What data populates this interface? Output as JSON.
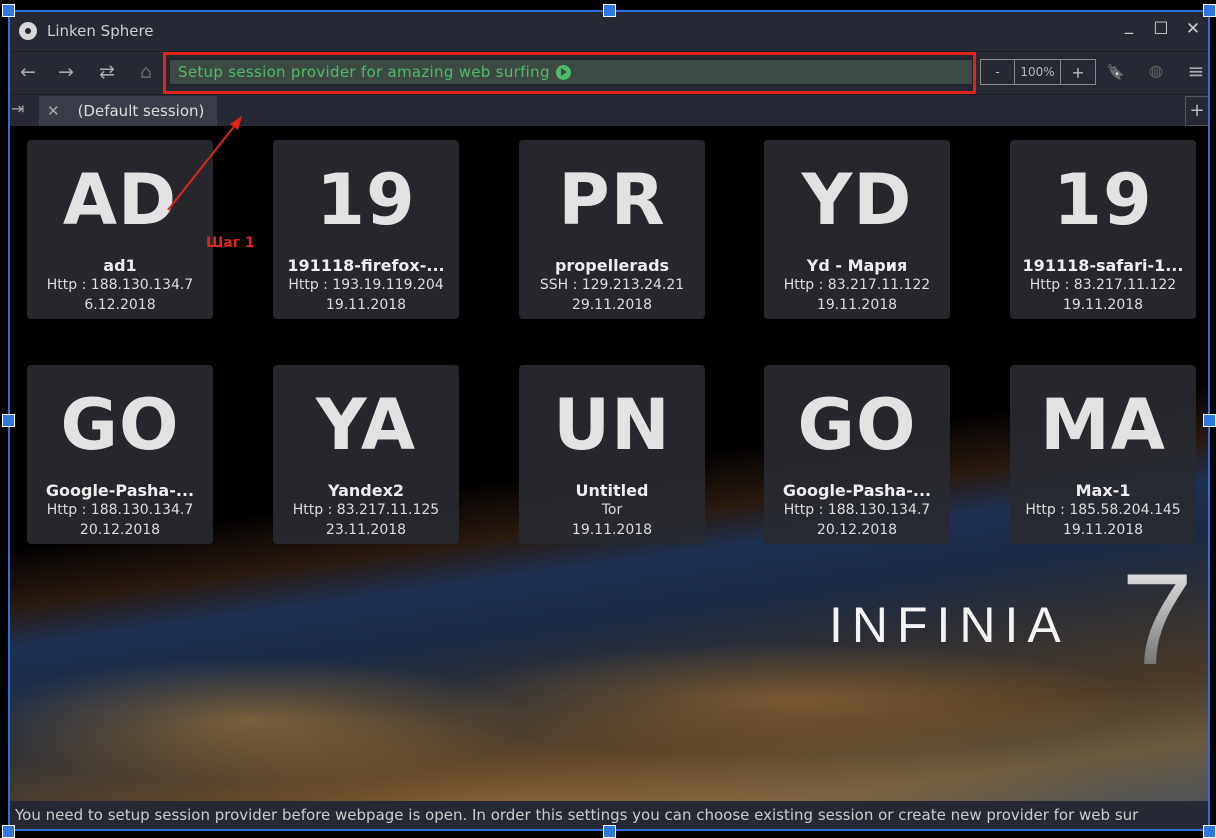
{
  "window": {
    "title": "Linken Sphere",
    "minimize": "_",
    "maximize": "☐",
    "close": "✕"
  },
  "toolbar": {
    "back": "←",
    "forward": "→",
    "reload": "⇄",
    "home": "⌂",
    "address": "Setup session provider for amazing web surfing",
    "zoom_out": "-",
    "zoom_level": "100%",
    "zoom_in": "+",
    "bookmark": "🔖",
    "extension": "◍",
    "menu": "≡"
  },
  "tabs": {
    "exit": "⇥",
    "close": "✕",
    "active": "(Default session)",
    "new": "+"
  },
  "sessions": [
    {
      "abbr": "AD",
      "name": "ad1",
      "conn": "Http : 188.130.134.7",
      "date": "6.12.2018"
    },
    {
      "abbr": "19",
      "name": "191118-firefox-...",
      "conn": "Http : 193.19.119.204",
      "date": "19.11.2018"
    },
    {
      "abbr": "PR",
      "name": "propellerads",
      "conn": "SSH : 129.213.24.21",
      "date": "29.11.2018"
    },
    {
      "abbr": "YD",
      "name": "Yd - Мария",
      "conn": "Http : 83.217.11.122",
      "date": "19.11.2018"
    },
    {
      "abbr": "19",
      "name": "191118-safari-1...",
      "conn": "Http : 83.217.11.122",
      "date": "19.11.2018"
    },
    {
      "abbr": "GO",
      "name": "Google-Pasha-...",
      "conn": "Http : 188.130.134.7",
      "date": "20.12.2018"
    },
    {
      "abbr": "YA",
      "name": "Yandex2",
      "conn": "Http : 83.217.11.125",
      "date": "23.11.2018"
    },
    {
      "abbr": "UN",
      "name": "Untitled",
      "conn": "Tor",
      "date": "19.11.2018"
    },
    {
      "abbr": "GO",
      "name": "Google-Pasha-...",
      "conn": "Http : 188.130.134.7",
      "date": "20.12.2018"
    },
    {
      "abbr": "MA",
      "name": "Max-1",
      "conn": "Http : 185.58.204.145",
      "date": "19.11.2018"
    }
  ],
  "branding": {
    "name": "INFINIA",
    "version": "7"
  },
  "annotation": {
    "label": "Шаг 1",
    "color": "#e0261c"
  },
  "status": "You need to setup session provider before webpage is open. In order this settings you can choose existing session or create new provider for web sur"
}
